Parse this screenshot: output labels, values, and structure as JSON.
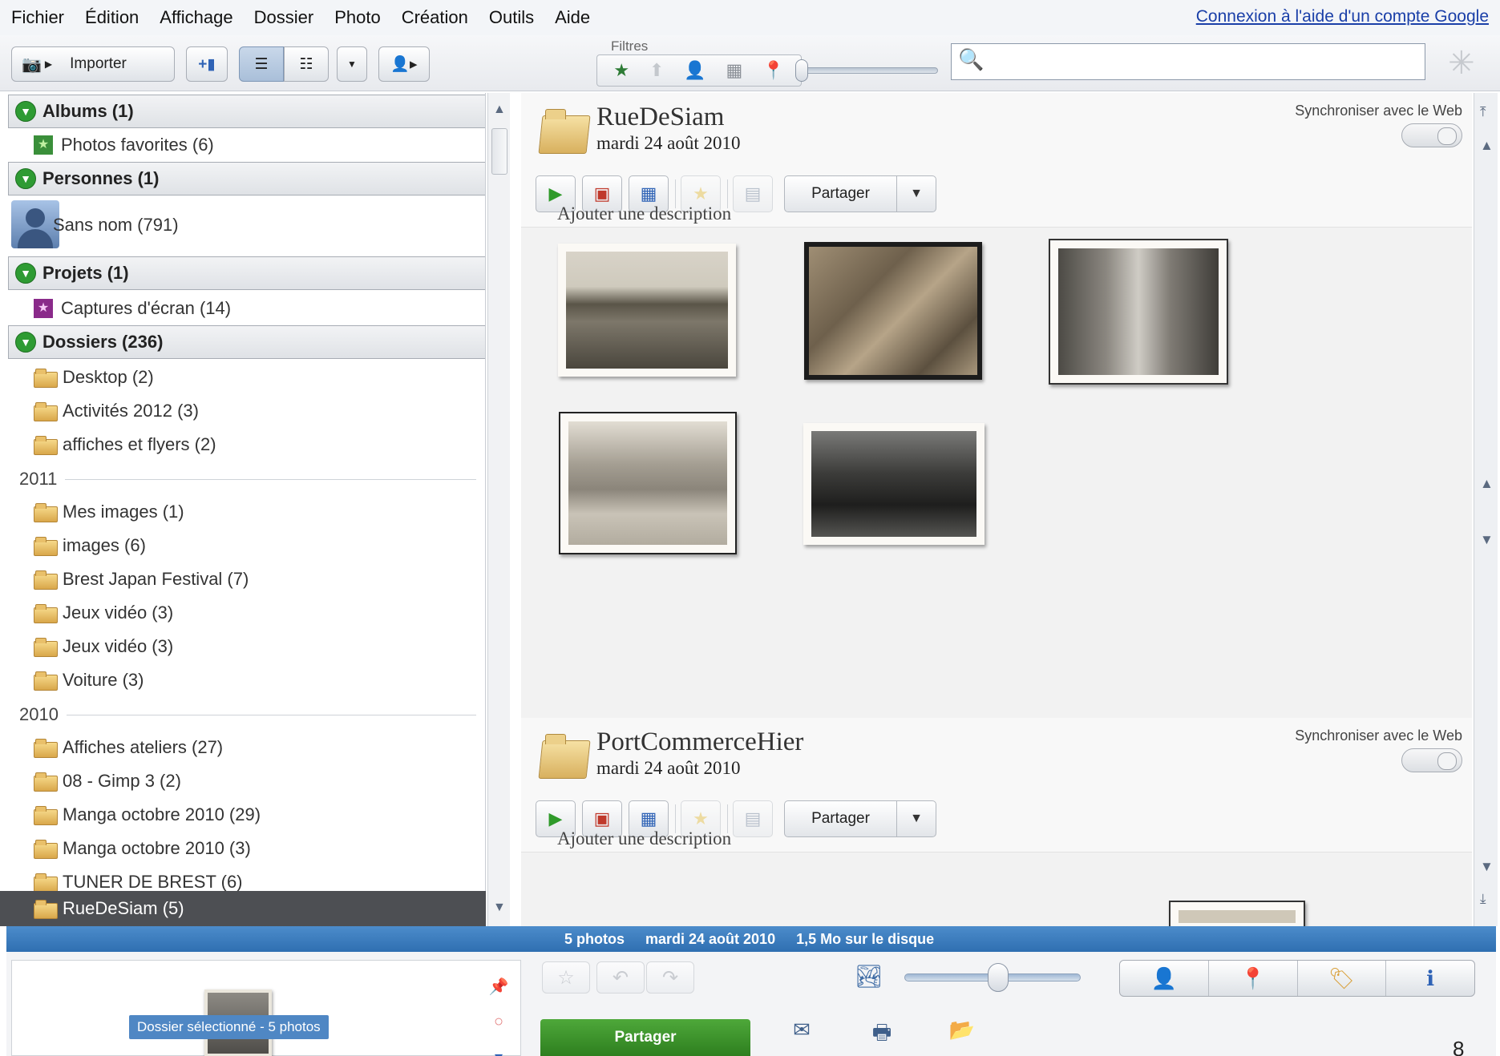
{
  "menu": {
    "items": [
      "Fichier",
      "Édition",
      "Affichage",
      "Dossier",
      "Photo",
      "Création",
      "Outils",
      "Aide"
    ],
    "login_link": "Connexion à l'aide d'un compte Google"
  },
  "toolbar": {
    "import_label": "Importer",
    "filters_label": "Filtres",
    "search_value": "",
    "filter_icons": [
      "star-icon",
      "upload-icon",
      "person-icon",
      "movie-icon",
      "map-pin-icon"
    ]
  },
  "sidebar": {
    "sections": {
      "albums": "Albums (1)",
      "personnes": "Personnes (1)",
      "projets": "Projets (1)",
      "dossiers": "Dossiers (236)"
    },
    "album_item": "Photos favorites (6)",
    "person_item": "Sans nom (791)",
    "project_item": "Captures d'écran (14)",
    "folders_top": [
      "Desktop (2)",
      "Activités 2012 (3)",
      "affiches et flyers (2)"
    ],
    "year_2011": "2011",
    "folders_2011": [
      "Mes images (1)",
      "images (6)",
      "Brest Japan Festival (7)",
      "Jeux vidéo (3)",
      "Jeux vidéo (3)",
      "Voiture (3)"
    ],
    "year_2010": "2010",
    "folders_2010": [
      "Affiches ateliers (27)",
      "08 - Gimp 3 (2)",
      "Manga octobre 2010 (29)",
      "Manga octobre 2010 (3)",
      "TUNER DE BREST (6)"
    ],
    "selected": "RueDeSiam (5)"
  },
  "main": {
    "folders": [
      {
        "title": "RueDeSiam",
        "date": "mardi 24 août 2010",
        "sync": "Synchroniser avec le Web",
        "share": "Partager",
        "description": "Ajouter une description"
      },
      {
        "title": "PortCommerceHier",
        "date": "mardi 24 août 2010",
        "sync": "Synchroniser avec le Web",
        "share": "Partager",
        "description": "Ajouter une description"
      }
    ]
  },
  "status": {
    "count": "5 photos",
    "date": "mardi 24 août 2010",
    "size": "1,5 Mo sur le disque"
  },
  "tray": {
    "label": "Dossier sélectionné - 5 photos"
  },
  "bottom": {
    "share_label": "Partager",
    "corner_number": "8"
  },
  "colors": {
    "status_bar": "#3b7dbf",
    "share_green": "#3a942b",
    "accent_link": "#1a3fa8"
  }
}
